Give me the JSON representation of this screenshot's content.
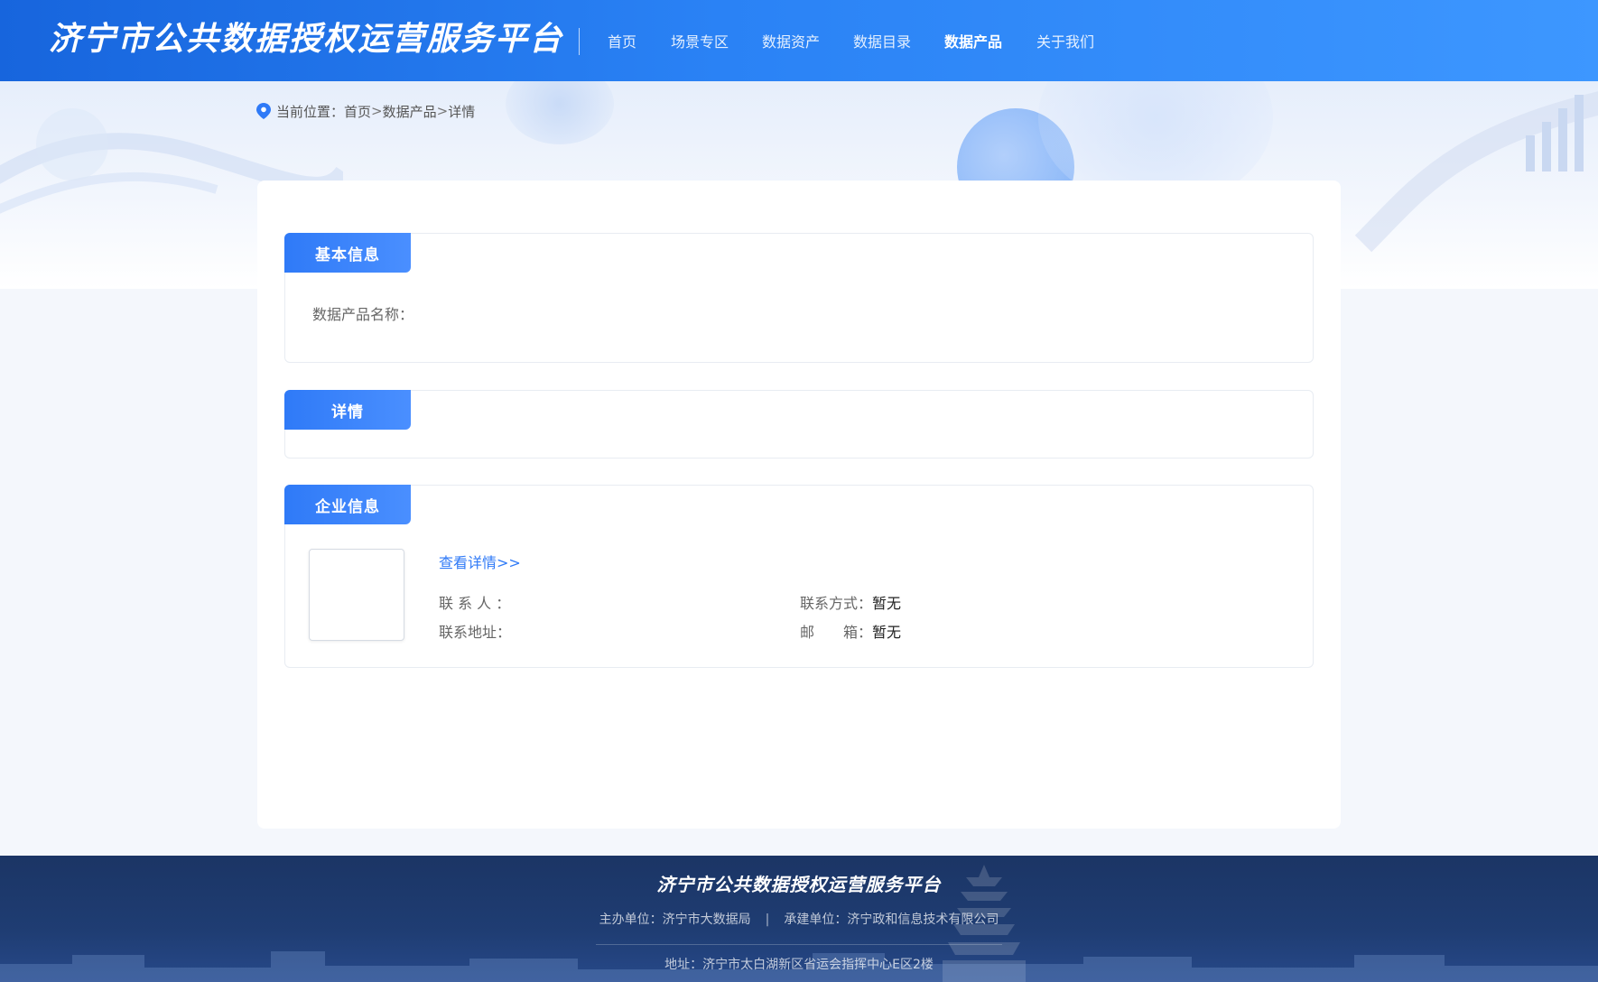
{
  "header": {
    "logo_text": "济宁市公共数据授权运营服务平台",
    "nav": [
      {
        "label": "首页",
        "active": false
      },
      {
        "label": "场景专区",
        "active": false
      },
      {
        "label": "数据资产",
        "active": false
      },
      {
        "label": "数据目录",
        "active": false
      },
      {
        "label": "数据产品",
        "active": true
      },
      {
        "label": "关于我们",
        "active": false
      }
    ]
  },
  "breadcrumb": {
    "icon": "location-pin-icon",
    "prefix": "当前位置：",
    "items": [
      "首页",
      "数据产品",
      "详情"
    ],
    "separator": ">"
  },
  "sections": {
    "basic": {
      "title": "基本信息",
      "product_name_label": "数据产品名称：",
      "product_name_value": ""
    },
    "detail": {
      "title": "详情"
    },
    "company": {
      "title": "企业信息",
      "view_detail_link": "查看详情>>",
      "contact_person_label": "联 系 人 ：",
      "contact_person_value": "",
      "contact_method_label": "联系方式：",
      "contact_method_value": "暂无",
      "address_label": "联系地址：",
      "address_value": "",
      "email_label": "邮　　箱：",
      "email_value": "暂无"
    }
  },
  "footer": {
    "logo_text": "济宁市公共数据授权运营服务平台",
    "host": "主办单位：济宁市大数据局",
    "separator": "|",
    "contractor": "承建单位：济宁政和信息技术有限公司",
    "address": "地址：济宁市太白湖新区省运会指挥中心E区2楼"
  },
  "colors": {
    "header_start": "#1765dd",
    "header_end": "#3d97ff",
    "accent": "#2f7af7",
    "footer_bg": "#1f3d73"
  }
}
